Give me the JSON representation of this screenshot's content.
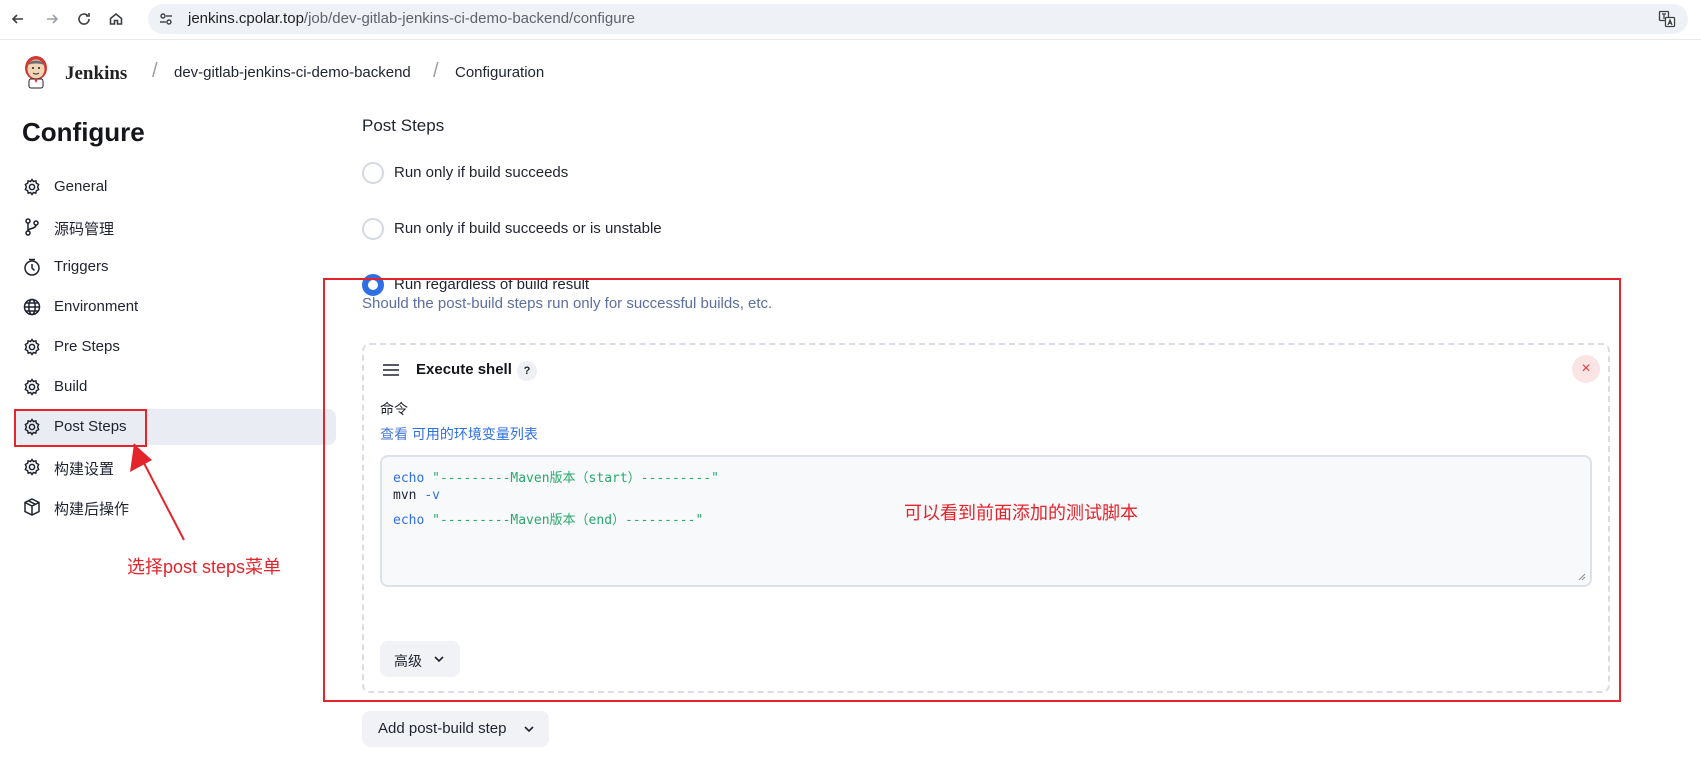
{
  "browser": {
    "url_host": "jenkins.cpolar.top",
    "url_path": "/job/dev-gitlab-jenkins-ci-demo-backend/configure"
  },
  "header": {
    "brand": "Jenkins",
    "breadcrumbs": [
      "dev-gitlab-jenkins-ci-demo-backend",
      "Configuration"
    ]
  },
  "sidebar": {
    "title": "Configure",
    "items": [
      {
        "label": "General",
        "icon": "gear-icon"
      },
      {
        "label": "源码管理",
        "icon": "branch-icon"
      },
      {
        "label": "Triggers",
        "icon": "clock-icon"
      },
      {
        "label": "Environment",
        "icon": "globe-icon"
      },
      {
        "label": "Pre Steps",
        "icon": "gear-icon"
      },
      {
        "label": "Build",
        "icon": "gear-icon"
      },
      {
        "label": "Post Steps",
        "icon": "gear-icon",
        "active": true
      },
      {
        "label": "构建设置",
        "icon": "gear-icon"
      },
      {
        "label": "构建后操作",
        "icon": "package-icon"
      }
    ]
  },
  "main": {
    "section_title": "Post Steps",
    "radios": [
      {
        "label": "Run only if build succeeds",
        "checked": false
      },
      {
        "label": "Run only if build succeeds or is unstable",
        "checked": false
      },
      {
        "label": "Run regardless of build result",
        "checked": true
      }
    ],
    "help_text": "Should the post-build steps run only for successful builds, etc.",
    "step": {
      "title": "Execute shell",
      "help": "?",
      "close": "×",
      "field_label": "命令",
      "env_link_prefix": "查看",
      "env_link": "可用的环境变量列表",
      "code": [
        {
          "kw": "echo",
          "rest": "\"---------Maven版本（start）---------\""
        },
        {
          "cmd": "mvn",
          "flag": "-v"
        },
        {
          "kw": "echo",
          "rest": "\"---------Maven版本（end）---------\""
        }
      ],
      "advanced": "高级"
    },
    "add_button": "Add post-build step"
  },
  "annotations": {
    "sidebar_note": "选择post steps菜单",
    "script_note": "可以看到前面添加的测试脚本",
    "color": "#e3242b"
  }
}
